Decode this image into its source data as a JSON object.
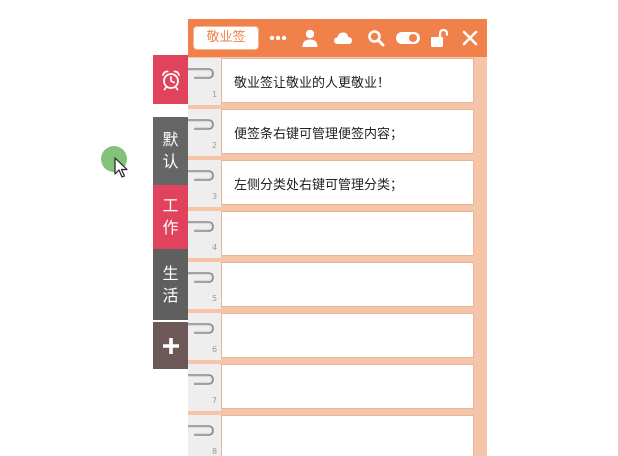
{
  "app": {
    "brand_label": "敬业签"
  },
  "toolbar": {
    "icons": [
      "more-icon",
      "user-icon",
      "cloud-icon",
      "search-icon",
      "toggle-icon",
      "unlock-icon",
      "close-icon"
    ]
  },
  "sidebar": {
    "alarm_icon": "alarm-clock-icon",
    "tabs": [
      {
        "label": "默认"
      },
      {
        "label": "工作"
      },
      {
        "label": "生活"
      }
    ],
    "add_icon": "plus-icon"
  },
  "notes": [
    {
      "num": "1",
      "text": "敬业签让敬业的人更敬业！"
    },
    {
      "num": "2",
      "text": "便签条右键可管理便签内容；"
    },
    {
      "num": "3",
      "text": "左侧分类处右键可管理分类；"
    },
    {
      "num": "4",
      "text": ""
    },
    {
      "num": "5",
      "text": ""
    },
    {
      "num": "6",
      "text": ""
    },
    {
      "num": "7",
      "text": ""
    },
    {
      "num": "8",
      "text": ""
    }
  ],
  "colors": {
    "titlebar": "#f0814a",
    "panel_bg": "#f6c4a9",
    "tab_red": "#e2435c",
    "tab_gray": "#656565",
    "tab_add": "#6c5856",
    "click_dot": "#7cbf72"
  }
}
